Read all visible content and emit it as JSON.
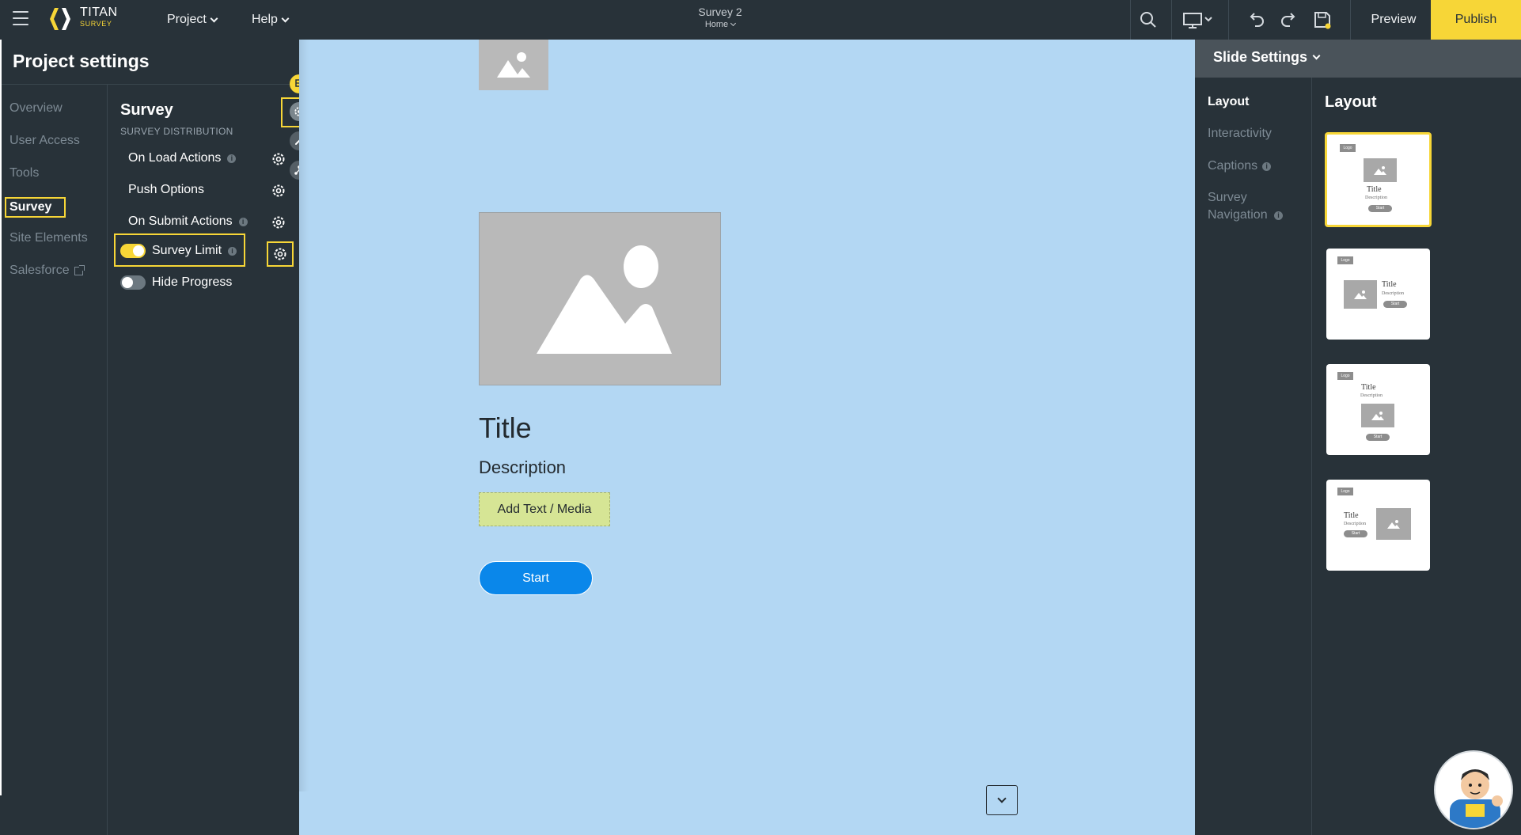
{
  "topbar": {
    "brand_line1": "TITAN",
    "brand_line2": "SURVEY",
    "menu_project": "Project",
    "menu_help": "Help",
    "doc_title": "Survey 2",
    "doc_page": "Home",
    "preview_label": "Preview",
    "publish_label": "Publish",
    "icons": [
      "menu-icon",
      "search-icon",
      "desktop-icon",
      "undo-icon",
      "redo-icon",
      "save-icon"
    ]
  },
  "project_settings": {
    "title": "Project settings",
    "nav": [
      {
        "label": "Overview"
      },
      {
        "label": "User Access"
      },
      {
        "label": "Tools"
      },
      {
        "label": "Survey",
        "active": true
      },
      {
        "label": "Site Elements"
      },
      {
        "label": "Salesforce",
        "external": true
      }
    ],
    "section_title": "Survey",
    "section_subtitle": "SURVEY DISTRIBUTION",
    "options": [
      {
        "label": "On Load Actions",
        "info": true,
        "gear": true
      },
      {
        "label": "Push Options",
        "info": false,
        "gear": true
      },
      {
        "label": "On Submit Actions",
        "info": true,
        "gear": true
      },
      {
        "label": "Survey Limit",
        "info": true,
        "gear": true,
        "toggle": "on"
      },
      {
        "label": "Hide Progress",
        "info": false,
        "gear": false,
        "toggle": "off"
      }
    ],
    "info_glyph": "i"
  },
  "canvas": {
    "title": "Title",
    "description": "Description",
    "add_text_label": "Add Text / Media",
    "start_label": "Start"
  },
  "slide_settings": {
    "header": "Slide Settings",
    "tabs": [
      {
        "label": "Layout",
        "active": true
      },
      {
        "label": "Interactivity"
      },
      {
        "label": "Captions",
        "info": true
      },
      {
        "label": "Survey Navigation",
        "info": true
      }
    ],
    "layout_title": "Layout",
    "layout_card_text": {
      "logo": "Logo",
      "title": "Title",
      "description": "Description",
      "start": "Start"
    }
  },
  "colors": {
    "topbar_bg": "#283239",
    "accent_yellow": "#f7d637",
    "canvas_bg": "#b3d7f3",
    "start_blue": "#0a87ea",
    "add_text_bg": "#d6e595"
  }
}
